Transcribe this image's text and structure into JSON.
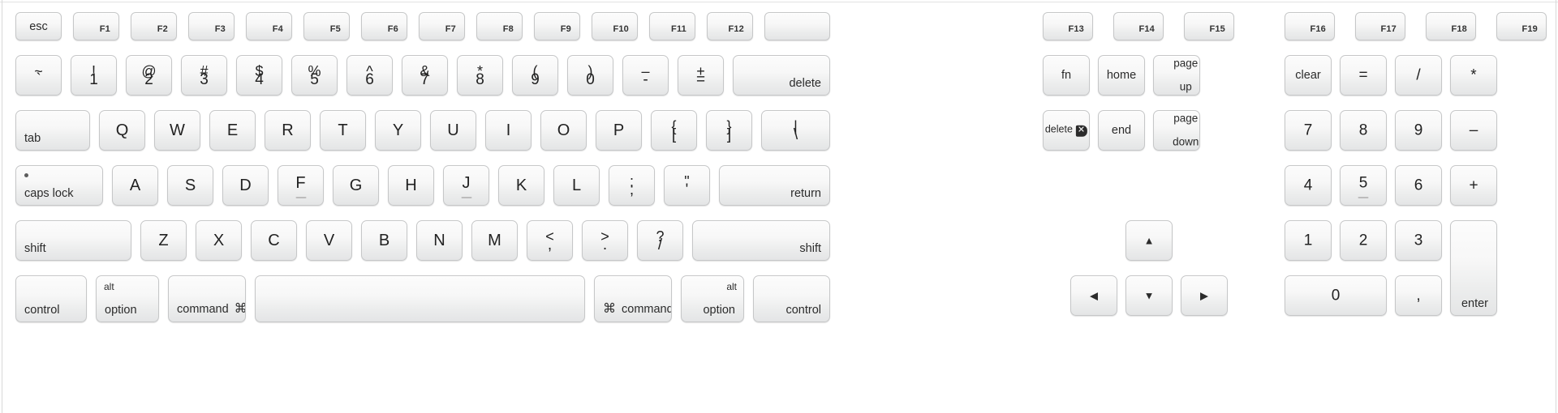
{
  "device": {
    "name": "Apple Extended Keyboard (US English)",
    "background_color": "#ffffff",
    "key_face_color": "#f4f5f5",
    "key_border_color": "#c6c7c8",
    "legend_color": "#2b2b2b"
  },
  "function_row": [
    {
      "id": "esc",
      "main": "esc",
      "icon": null,
      "fkey": null
    },
    {
      "id": "f1",
      "main": null,
      "icon": "brightness-down-icon",
      "fkey": "F1"
    },
    {
      "id": "f2",
      "main": null,
      "icon": "brightness-up-icon",
      "fkey": "F2"
    },
    {
      "id": "f3",
      "main": null,
      "icon": "expose-icon",
      "fkey": "F3"
    },
    {
      "id": "f4",
      "main": null,
      "icon": "dashboard-icon",
      "fkey": "F4"
    },
    {
      "id": "f5",
      "main": null,
      "icon": null,
      "fkey": "F5"
    },
    {
      "id": "f6",
      "main": null,
      "icon": null,
      "fkey": "F6"
    },
    {
      "id": "f7",
      "main": null,
      "icon": "rewind-icon",
      "fkey": "F7"
    },
    {
      "id": "f8",
      "main": null,
      "icon": "play-pause-icon",
      "fkey": "F8"
    },
    {
      "id": "f9",
      "main": null,
      "icon": "fast-forward-icon",
      "fkey": "F9"
    },
    {
      "id": "f10",
      "main": null,
      "icon": "mute-icon",
      "fkey": "F10"
    },
    {
      "id": "f11",
      "main": null,
      "icon": "volume-down-icon",
      "fkey": "F11"
    },
    {
      "id": "f12",
      "main": null,
      "icon": "volume-up-icon",
      "fkey": "F12"
    },
    {
      "id": "eject",
      "main": null,
      "icon": "eject-icon",
      "fkey": null
    }
  ],
  "function_row_right": [
    {
      "id": "f13",
      "fkey": "F13"
    },
    {
      "id": "f14",
      "fkey": "F14"
    },
    {
      "id": "f15",
      "fkey": "F15"
    }
  ],
  "function_row_keypad": [
    {
      "id": "f16",
      "fkey": "F16"
    },
    {
      "id": "f17",
      "fkey": "F17"
    },
    {
      "id": "f18",
      "fkey": "F18"
    },
    {
      "id": "f19",
      "fkey": "F19"
    }
  ],
  "number_row": [
    {
      "id": "grave",
      "top": "~",
      "bottom": "`"
    },
    {
      "id": "1",
      "top": "!",
      "bottom": "1"
    },
    {
      "id": "2",
      "top": "@",
      "bottom": "2"
    },
    {
      "id": "3",
      "top": "#",
      "bottom": "3"
    },
    {
      "id": "4",
      "top": "$",
      "bottom": "4"
    },
    {
      "id": "5",
      "top": "%",
      "bottom": "5"
    },
    {
      "id": "6",
      "top": "^",
      "bottom": "6"
    },
    {
      "id": "7",
      "top": "&",
      "bottom": "7"
    },
    {
      "id": "8",
      "top": "*",
      "bottom": "8"
    },
    {
      "id": "9",
      "top": "(",
      "bottom": "9"
    },
    {
      "id": "0",
      "top": ")",
      "bottom": "0"
    },
    {
      "id": "minus",
      "top": "–",
      "bottom": "-"
    },
    {
      "id": "equal",
      "top": "+",
      "bottom": "="
    }
  ],
  "number_row_delete": "delete",
  "tab_row": {
    "tab_label": "tab",
    "letters": [
      "Q",
      "W",
      "E",
      "R",
      "T",
      "Y",
      "U",
      "I",
      "O",
      "P"
    ],
    "brackets": [
      {
        "id": "lbracket",
        "top": "{",
        "bottom": "["
      },
      {
        "id": "rbracket",
        "top": "}",
        "bottom": "]"
      },
      {
        "id": "backslash",
        "top": "|",
        "bottom": "\\"
      }
    ]
  },
  "home_row": {
    "caps_lock_label": "caps lock",
    "letters": [
      "A",
      "S",
      "D",
      "F",
      "G",
      "H",
      "J",
      "K",
      "L"
    ],
    "homing_letters": [
      "F",
      "J"
    ],
    "punct": [
      {
        "id": "semicolon",
        "top": ":",
        "bottom": ";"
      },
      {
        "id": "quote",
        "top": "\"",
        "bottom": "'"
      }
    ],
    "return_label": "return"
  },
  "shift_row": {
    "left_shift_label": "shift",
    "letters": [
      "Z",
      "X",
      "C",
      "V",
      "B",
      "N",
      "M"
    ],
    "punct": [
      {
        "id": "comma",
        "top": "<",
        "bottom": ","
      },
      {
        "id": "period",
        "top": ">",
        "bottom": "."
      },
      {
        "id": "slash",
        "top": "?",
        "bottom": "/"
      }
    ],
    "right_shift_label": "shift"
  },
  "bottom_row": {
    "control_left": "control",
    "option_left": {
      "top": "alt",
      "bottom": "option"
    },
    "command_left": {
      "label": "command",
      "glyph": "⌘"
    },
    "space": "",
    "command_right": {
      "label": "command",
      "glyph": "⌘"
    },
    "option_right": {
      "top": "alt",
      "bottom": "option"
    },
    "control_right": "control"
  },
  "nav_cluster": [
    {
      "id": "fn",
      "label": "fn",
      "sub": null,
      "icon": null
    },
    {
      "id": "home",
      "label": "home",
      "sub": null,
      "icon": null
    },
    {
      "id": "page-up",
      "label": "page",
      "sub": "up",
      "icon": null
    },
    {
      "id": "fwd-delete",
      "label": "delete",
      "sub": null,
      "icon": "forward-delete-icon"
    },
    {
      "id": "end",
      "label": "end",
      "sub": null,
      "icon": null
    },
    {
      "id": "page-down",
      "label": "page",
      "sub": "down",
      "icon": null
    }
  ],
  "arrow_cluster": [
    {
      "id": "arrow-up",
      "icon": "arrow-up-icon",
      "glyph": "▲"
    },
    {
      "id": "arrow-left",
      "icon": "arrow-left-icon",
      "glyph": "◀"
    },
    {
      "id": "arrow-down",
      "icon": "arrow-down-icon",
      "glyph": "▼"
    },
    {
      "id": "arrow-right",
      "icon": "arrow-right-icon",
      "glyph": "▶"
    }
  ],
  "keypad": {
    "row1": [
      "clear",
      "=",
      "/",
      "*"
    ],
    "row2": [
      "7",
      "8",
      "9",
      "–"
    ],
    "row3": [
      "4",
      "5",
      "6",
      "+"
    ],
    "row4": [
      "1",
      "2",
      "3"
    ],
    "row5": [
      "0",
      ","
    ],
    "enter_label": "enter",
    "homing_key": "5"
  }
}
